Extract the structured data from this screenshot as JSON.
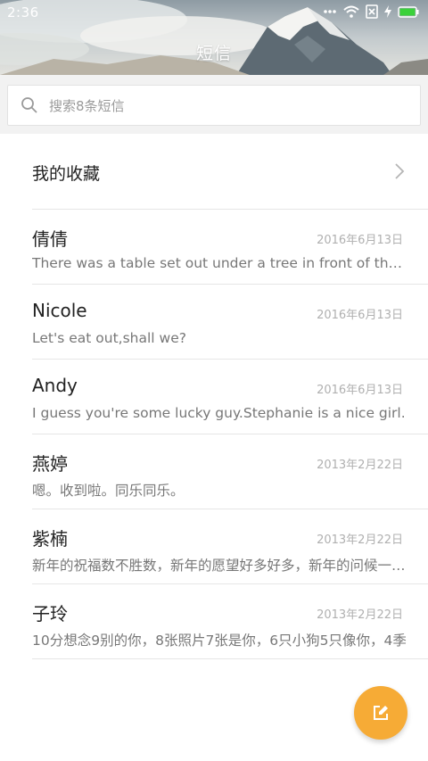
{
  "status_bar": {
    "time": "2:36",
    "icons": [
      "more-dots-icon",
      "wifi-icon",
      "sim-off-icon",
      "charging-bolt-icon",
      "battery-icon"
    ],
    "battery_color": "#3bd13b"
  },
  "header": {
    "title": "短信"
  },
  "search": {
    "placeholder": "搜索8条短信"
  },
  "favorites": {
    "label": "我的收藏"
  },
  "messages": [
    {
      "name": "倩倩",
      "date": "2016年6月13日",
      "preview": "There was a table set out under a tree in front of the house"
    },
    {
      "name": "Nicole",
      "date": "2016年6月13日",
      "preview": "Let's eat out,shall we?"
    },
    {
      "name": "Andy",
      "date": "2016年6月13日",
      "preview": "I guess you're some lucky guy.Stephanie is a nice girl."
    },
    {
      "name": "燕婷",
      "date": "2013年2月22日",
      "preview": "嗯。收到啦。同乐同乐。"
    },
    {
      "name": "紫楠",
      "date": "2013年2月22日",
      "preview": "新年的祝福数不胜数，新年的愿望好多好多，新年的问候一声声"
    },
    {
      "name": "子玲",
      "date": "2013年2月22日",
      "preview": "10分想念9别的你，8张照片7张是你，6只小狗5只像你，4季"
    }
  ],
  "fab": {
    "icon": "compose-icon",
    "color": "#f6ab36"
  }
}
